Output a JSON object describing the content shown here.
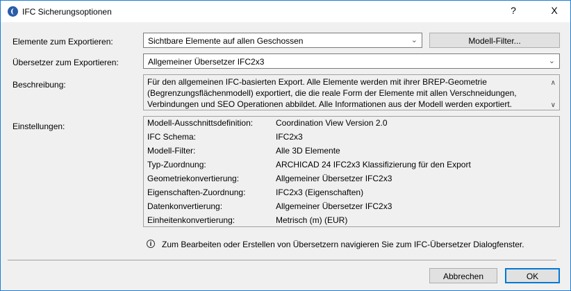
{
  "window": {
    "title": "IFC Sicherungsoptionen",
    "help": "?",
    "close": "X"
  },
  "elements": {
    "label": "Elemente zum Exportieren:",
    "value": "Sichtbare Elemente auf allen Geschossen",
    "filter_button": "Modell-Filter..."
  },
  "translator": {
    "label": "Übersetzer zum Exportieren:",
    "value": "Allgemeiner Übersetzer IFC2x3"
  },
  "description": {
    "label": "Beschreibung:",
    "text": "Für den allgemeinen IFC-basierten Export. Alle Elemente werden mit ihrer BREP-Geometrie (Begrenzungsflächenmodell) exportiert, die die reale Form der Elemente mit allen Verschneidungen, Verbindungen und SEO Operationen abbildet. Alle Informationen aus der Modell werden exportiert."
  },
  "settings": {
    "label": "Einstellungen:",
    "rows": [
      {
        "key": "Modell-Ausschnittsdefinition:",
        "value": "Coordination View Version 2.0"
      },
      {
        "key": "IFC Schema:",
        "value": "IFC2x3"
      },
      {
        "key": "Modell-Filter:",
        "value": "Alle 3D Elemente"
      },
      {
        "key": "Typ-Zuordnung:",
        "value": "ARCHICAD 24 IFC2x3 Klassifizierung für den Export"
      },
      {
        "key": "Geometriekonvertierung:",
        "value": "Allgemeiner Übersetzer IFC2x3"
      },
      {
        "key": "Eigenschaften-Zuordnung:",
        "value": "IFC2x3 (Eigenschaften)"
      },
      {
        "key": "Datenkonvertierung:",
        "value": "Allgemeiner Übersetzer IFC2x3"
      },
      {
        "key": "Einheitenkonvertierung:",
        "value": "Metrisch (m) (EUR)"
      }
    ]
  },
  "info": "Zum Bearbeiten oder Erstellen von Übersetzern navigieren Sie zum IFC-Übersetzer Dialogfenster.",
  "buttons": {
    "cancel": "Abbrechen",
    "ok": "OK"
  }
}
